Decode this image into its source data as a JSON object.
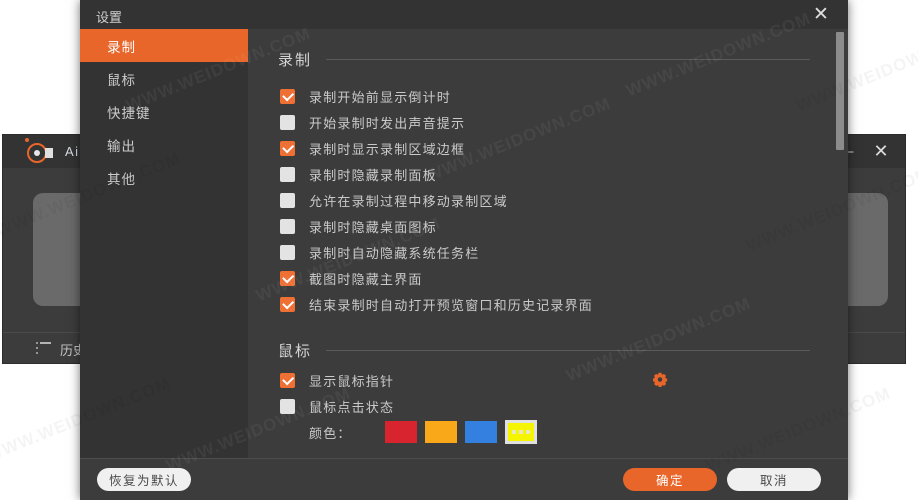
{
  "background_window": {
    "app_title": "Aisee",
    "logo_icon": "record-circle-icon",
    "minimize_icon": "minimize-icon",
    "close_icon": "close-icon",
    "footer": {
      "list_icon": "list-icon",
      "history_label": "历史"
    }
  },
  "dialog": {
    "title": "设置",
    "close_icon": "close-icon",
    "sidebar": {
      "items": [
        {
          "label": "录制",
          "active": true
        },
        {
          "label": "鼠标",
          "active": false
        },
        {
          "label": "快捷键",
          "active": false
        },
        {
          "label": "输出",
          "active": false
        },
        {
          "label": "其他",
          "active": false
        }
      ]
    },
    "sections": [
      {
        "title": "录制",
        "checkboxes": [
          {
            "label": "录制开始前显示倒计时",
            "checked": true
          },
          {
            "label": "开始录制时发出声音提示",
            "checked": false
          },
          {
            "label": "录制时显示录制区域边框",
            "checked": true
          },
          {
            "label": "录制时隐藏录制面板",
            "checked": false
          },
          {
            "label": "允许在录制过程中移动录制区域",
            "checked": false
          },
          {
            "label": "录制时隐藏桌面图标",
            "checked": false
          },
          {
            "label": "录制时自动隐藏系统任务栏",
            "checked": false
          },
          {
            "label": "截图时隐藏主界面",
            "checked": true
          },
          {
            "label": "结束录制时自动打开预览窗口和历史记录界面",
            "checked": true
          }
        ]
      },
      {
        "title": "鼠标",
        "checkboxes": [
          {
            "label": "显示鼠标指针",
            "checked": true,
            "gear_icon": "gear-icon"
          },
          {
            "label": "鼠标点击状态",
            "checked": false
          }
        ],
        "color_picker": {
          "label": "颜色：",
          "swatches": [
            {
              "color": "#d8242f",
              "selected": false
            },
            {
              "color": "#f9a81a",
              "selected": false
            },
            {
              "color": "#3380e0",
              "selected": false
            },
            {
              "color": "#f5f500",
              "selected": true
            }
          ]
        }
      }
    ],
    "footer": {
      "restore_default_label": "恢复为默认",
      "ok_label": "确定",
      "cancel_label": "取消"
    },
    "scrollbar": {
      "name": "vertical-scrollbar"
    }
  },
  "watermark": {
    "text": "WWW.WEIDOWN.COM"
  },
  "colors": {
    "accent": "#e8662a",
    "dialog_bg": "#3c3c3c",
    "sidebar_bg": "#333333"
  }
}
